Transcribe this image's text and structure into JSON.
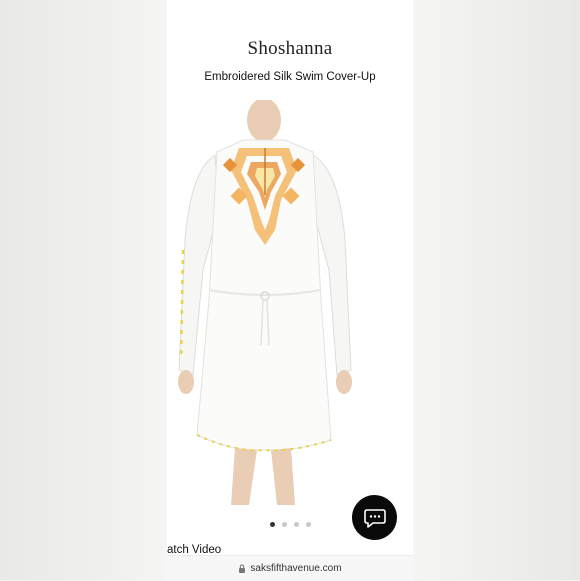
{
  "header": {
    "brand": "Shoshanna",
    "product_name": "Embroidered Silk Swim Cover-Up"
  },
  "gallery": {
    "image_subject": "white embroidered silk tunic cover-up",
    "dot_count": 4,
    "active_index": 0
  },
  "video_link": {
    "label": "atch Video"
  },
  "chat": {
    "icon": "chat-bubble-icon"
  },
  "browser": {
    "lock_icon": "lock-icon",
    "url": "saksfifthavenue.com"
  },
  "colors": {
    "accent_black": "#0a0a0a",
    "embroidery_orange": "#e8923a",
    "embroidery_yellow": "#e7d44a"
  }
}
